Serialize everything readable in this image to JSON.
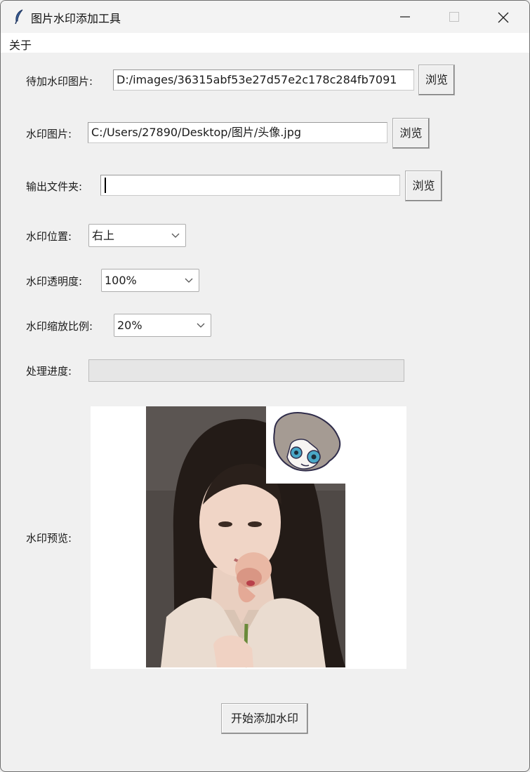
{
  "window": {
    "title": "图片水印添加工具"
  },
  "menu": {
    "about": "关于"
  },
  "form": {
    "source_label": "待加水印图片:",
    "source_value": "D:/images/36315abf53e27d57e2c178c284fb7091",
    "watermark_label": "水印图片:",
    "watermark_value": "C:/Users/27890/Desktop/图片/头像.jpg",
    "output_label": "输出文件夹:",
    "output_value": "",
    "browse_label": "浏览",
    "position_label": "水印位置:",
    "position_value": "右上",
    "opacity_label": "水印透明度:",
    "opacity_value": "100%",
    "scale_label": "水印缩放比例:",
    "scale_value": "20%",
    "progress_label": "处理进度:",
    "progress_fraction": 0,
    "preview_label": "水印预览:",
    "start_button": "开始添加水印"
  }
}
